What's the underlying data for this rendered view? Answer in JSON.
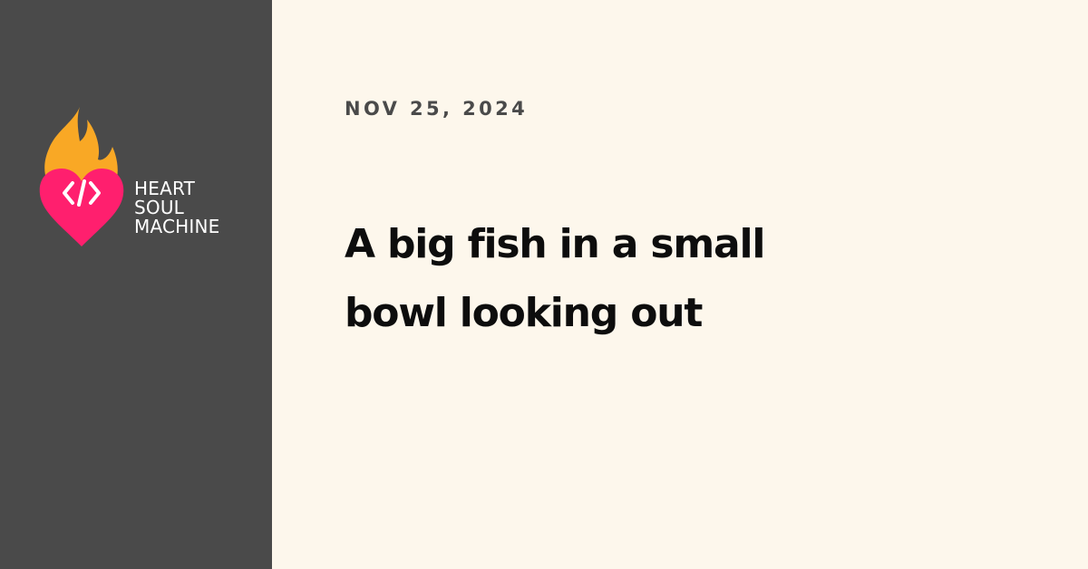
{
  "brand": {
    "lines": [
      "HEART",
      "SOUL",
      "MACHINE"
    ],
    "colors": {
      "flame": "#f9a825",
      "heart": "#ff1f6e",
      "code": "#ffffff"
    },
    "icon": "flaming-heart-code-icon"
  },
  "post": {
    "date": "NOV 25, 2024",
    "title": "A big fish in a small bowl looking out"
  },
  "colors": {
    "sidebar": "#4a4a4a",
    "background": "#fdf7ec",
    "title": "#0d0d0d",
    "date": "#4a4a4a"
  }
}
